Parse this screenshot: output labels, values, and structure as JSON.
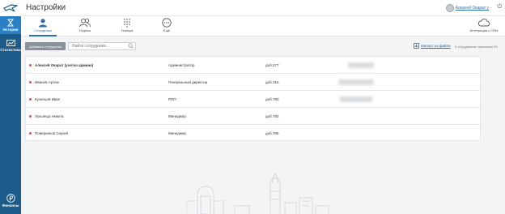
{
  "sidebar": {
    "history_label": "История",
    "stats_label": "Статистика",
    "finance_label": "Финансы"
  },
  "header": {
    "title": "Настройки",
    "user_name": "Алексей Окарат у"
  },
  "tabs": {
    "employees": "Сотрудники",
    "departments": "Отделы",
    "numbers": "Номера",
    "more": "Ещё",
    "crm": "Интеграция с CRM"
  },
  "toolbar": {
    "add_label": "Добавить сотрудника",
    "search_placeholder": "Найти сотрудника",
    "import_label": "Импорт из файла",
    "count_text": "5 сотрудников, максимум 20"
  },
  "employees": [
    {
      "name": "Алексей Окарат (учетка админа)",
      "role": "Администратор",
      "ext": "доб.277"
    },
    {
      "name": "Иванов Артем",
      "role": "Генеральный директор",
      "ext": "доб.315"
    },
    {
      "name": "Кузнецов Иван",
      "role": "РОП",
      "ext": "доб.783"
    },
    {
      "name": "Лукьянца Никита",
      "role": "Менеджер",
      "ext": "доб.784"
    },
    {
      "name": "Поверенков Сергей",
      "role": "Менеджер",
      "ext": "доб.785"
    }
  ],
  "colors": {
    "sidebar": "#1c5b8a",
    "sidebar_active": "#2980c4",
    "accent": "#2a6fb0",
    "status_dot": "#d9534f"
  }
}
